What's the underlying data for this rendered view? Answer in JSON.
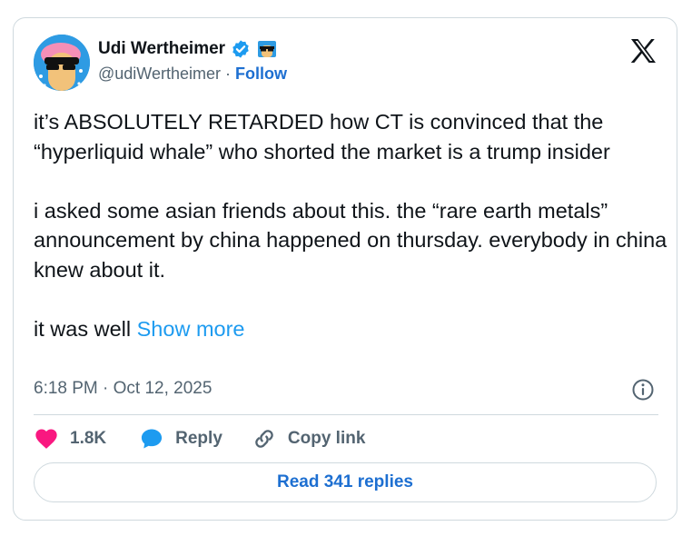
{
  "author": {
    "name": "Udi Wertheimer",
    "handle": "@udiWertheimer",
    "separator": "·",
    "follow_label": "Follow"
  },
  "tweet": {
    "paragraphs": [
      "it’s ABSOLUTELY RETARDED how CT is convinced that the “hyperliquid whale” who shorted the market is a trump insider",
      "i asked some asian friends about this. the “rare earth metals” announcement by china happened on thursday. everybody in china knew about it.",
      "it was well"
    ],
    "show_more": "Show more",
    "timestamp": "6:18 PM · Oct 12, 2025"
  },
  "actions": {
    "likes": "1.8K",
    "reply_label": "Reply",
    "copy_link_label": "Copy link"
  },
  "read_replies_label": "Read 341 replies",
  "colors": {
    "like": "#f91880",
    "link": "#1d9bf0",
    "follow": "#1d6fd1",
    "muted": "#536471",
    "border": "#cfd9de"
  }
}
